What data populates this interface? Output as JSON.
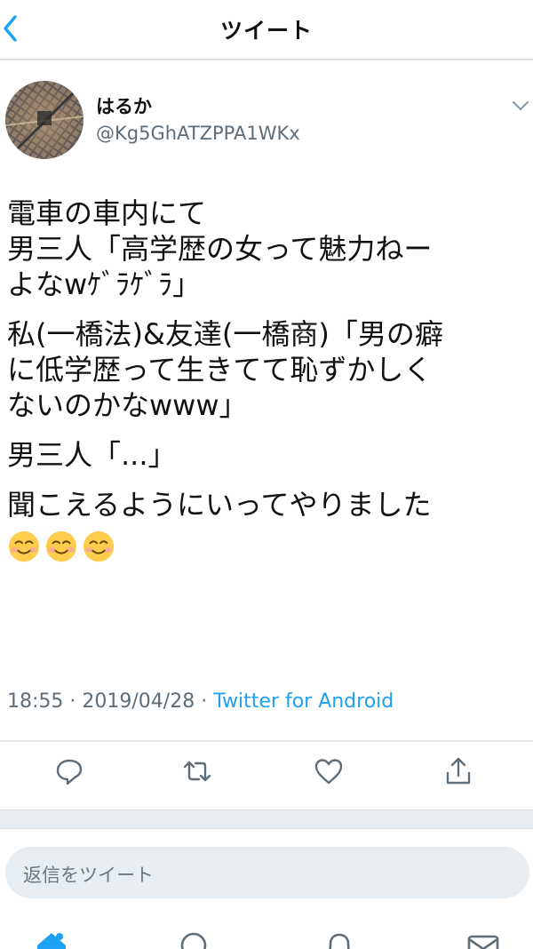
{
  "header": {
    "title": "ツイート",
    "back_icon": "chevron-left-icon"
  },
  "author": {
    "display_name": "はるか",
    "handle": "@Kg5GhATZPPA1WKx",
    "avatar_icon": "avatar-aerial-city"
  },
  "tweet": {
    "paragraphs": [
      "電車の車内にて\n男三人「高学歴の女って魅力ねー\nよなwｹﾞﾗｹﾞﾗ」",
      "私(一橋法)&友達(一橋商)「男の癖\nに低学歴って生きてて恥ずかしく\nないのかなwww」",
      "男三人「...」",
      "聞こえるようにいってやりました"
    ],
    "emoji": [
      "smiling-face-emoji",
      "smiling-face-emoji",
      "smiling-face-emoji"
    ]
  },
  "meta": {
    "time": "18:55",
    "separator": "·",
    "date": "2019/04/28",
    "via": "Twitter for Android"
  },
  "actions": [
    {
      "name": "reply-icon"
    },
    {
      "name": "retweet-icon"
    },
    {
      "name": "like-icon"
    },
    {
      "name": "share-icon"
    }
  ],
  "reply": {
    "placeholder": "返信をツイート"
  },
  "nav": [
    "home-icon",
    "search-icon",
    "notifications-icon",
    "messages-icon"
  ],
  "colors": {
    "accent": "#1da1f2",
    "secondary_text": "#5f6d79",
    "icon_gray": "#5f6d79",
    "divider": "#e1e6ea"
  }
}
